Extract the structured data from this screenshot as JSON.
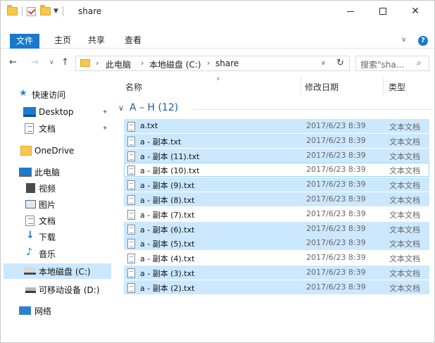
{
  "window": {
    "title": "share",
    "quick_access_icons": [
      "folder-icon",
      "properties-check-icon",
      "new-folder-icon",
      "customize-dropdown-icon"
    ]
  },
  "ribbon": {
    "tabs": [
      {
        "label": "文件",
        "active": true
      },
      {
        "label": "主页"
      },
      {
        "label": "共享"
      },
      {
        "label": "查看"
      }
    ],
    "help": "?"
  },
  "address": {
    "crumbs": [
      "此电脑",
      "本地磁盘 (C:)",
      "share"
    ],
    "search_placeholder": "搜索\"sha...",
    "glyphs": {
      "back": "←",
      "forward": "→",
      "recent": "∨",
      "up": "↑",
      "sep": "›",
      "dropdown": "∨",
      "refresh": "↻",
      "search": "⌕"
    }
  },
  "window_controls": {
    "close": "✕"
  },
  "navpane": {
    "items": [
      {
        "label": "快速访问",
        "icon": "star-icon"
      },
      {
        "label": "Desktop",
        "icon": "desktop-icon",
        "pinned": true
      },
      {
        "label": "文档",
        "icon": "documents-icon",
        "pinned": true
      },
      {
        "label": "OneDrive",
        "icon": "folder-icon"
      },
      {
        "label": "此电脑",
        "icon": "computer-icon"
      },
      {
        "label": "视频",
        "icon": "video-icon"
      },
      {
        "label": "图片",
        "icon": "pictures-icon"
      },
      {
        "label": "文档",
        "icon": "documents-icon"
      },
      {
        "label": "下载",
        "icon": "download-icon"
      },
      {
        "label": "音乐",
        "icon": "music-icon"
      },
      {
        "label": "本地磁盘 (C:)",
        "icon": "drive-icon",
        "selected": true
      },
      {
        "label": "可移动设备 (D:)",
        "icon": "usb-drive-icon"
      },
      {
        "label": "网络",
        "icon": "network-icon"
      }
    ],
    "pin_glyph": "✦"
  },
  "content": {
    "columns": {
      "name": "名称",
      "date": "修改日期",
      "type": "类型"
    },
    "group_label": "A – H (12)",
    "group_chevron": "∨",
    "files": [
      {
        "name": "a.txt",
        "date": "2017/6/23 8:39",
        "type": "文本文档",
        "selected": true
      },
      {
        "name": "a - 副本.txt",
        "date": "2017/6/23 8:39",
        "type": "文本文档",
        "selected": true
      },
      {
        "name": "a - 副本 (11).txt",
        "date": "2017/6/23 8:39",
        "type": "文本文档",
        "selected": true
      },
      {
        "name": "a - 副本 (10).txt",
        "date": "2017/6/23 8:39",
        "type": "文本文档",
        "selected": false,
        "focused": true
      },
      {
        "name": "a - 副本 (9).txt",
        "date": "2017/6/23 8:39",
        "type": "文本文档",
        "selected": true
      },
      {
        "name": "a - 副本 (8).txt",
        "date": "2017/6/23 8:39",
        "type": "文本文档",
        "selected": true
      },
      {
        "name": "a - 副本 (7).txt",
        "date": "2017/6/23 8:39",
        "type": "文本文档",
        "selected": false
      },
      {
        "name": "a - 副本 (6).txt",
        "date": "2017/6/23 8:39",
        "type": "文本文档",
        "selected": true
      },
      {
        "name": "a - 副本 (5).txt",
        "date": "2017/6/23 8:39",
        "type": "文本文档",
        "selected": true
      },
      {
        "name": "a - 副本 (4).txt",
        "date": "2017/6/23 8:39",
        "type": "文本文档",
        "selected": false
      },
      {
        "name": "a - 副本 (3).txt",
        "date": "2017/6/23 8:39",
        "type": "文本文档",
        "selected": true
      },
      {
        "name": "a - 副本 (2).txt",
        "date": "2017/6/23 8:39",
        "type": "文本文档",
        "selected": true
      }
    ]
  },
  "colors": {
    "accent": "#1979ca",
    "selection": "#cce8ff",
    "focus_border": "#99d1ff",
    "group_text": "#1e5aa8"
  }
}
